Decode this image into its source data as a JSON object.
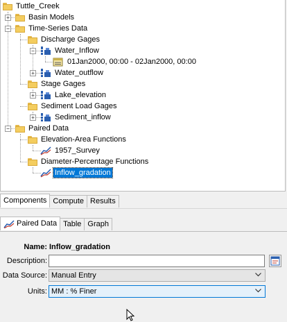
{
  "tree": {
    "root": "Tuttle_Creek",
    "basin_models": "Basin Models",
    "time_series_data": "Time-Series Data",
    "discharge_gages": "Discharge Gages",
    "water_inflow": "Water_Inflow",
    "water_inflow_window": "01Jan2000, 00:00 - 02Jan2000, 00:00",
    "water_outflow": "Water_outflow",
    "stage_gages": "Stage Gages",
    "lake_elevation": "Lake_elevation",
    "sediment_load_gages": "Sediment Load Gages",
    "sediment_inflow": "Sediment_inflow",
    "paired_data": "Paired Data",
    "elevation_area_functions": "Elevation-Area Functions",
    "survey_1957": "1957_Survey",
    "diameter_percentage_functions": "Diameter-Percentage Functions",
    "inflow_gradation": "Inflow_gradation"
  },
  "bottom_tabs": [
    "Components",
    "Compute",
    "Results"
  ],
  "component_tabs": [
    "Paired Data",
    "Table",
    "Graph"
  ],
  "form": {
    "name_label": "Name:",
    "name_value": "Inflow_gradation",
    "description_label": "Description:",
    "description_value": "",
    "data_source_label": "Data Source:",
    "data_source_value": "Manual Entry",
    "units_label": "Units:",
    "units_value": "MM : % Finer"
  },
  "colors": {
    "selection": "#0078d7",
    "folder": "#f4cd5f",
    "gage": "#2b5fb0"
  },
  "icons": {
    "folder": "folder-icon",
    "gage": "gage-icon",
    "curve": "paired-data-curve-icon",
    "time_window": "time-window-icon",
    "edit": "edit-description-icon"
  }
}
